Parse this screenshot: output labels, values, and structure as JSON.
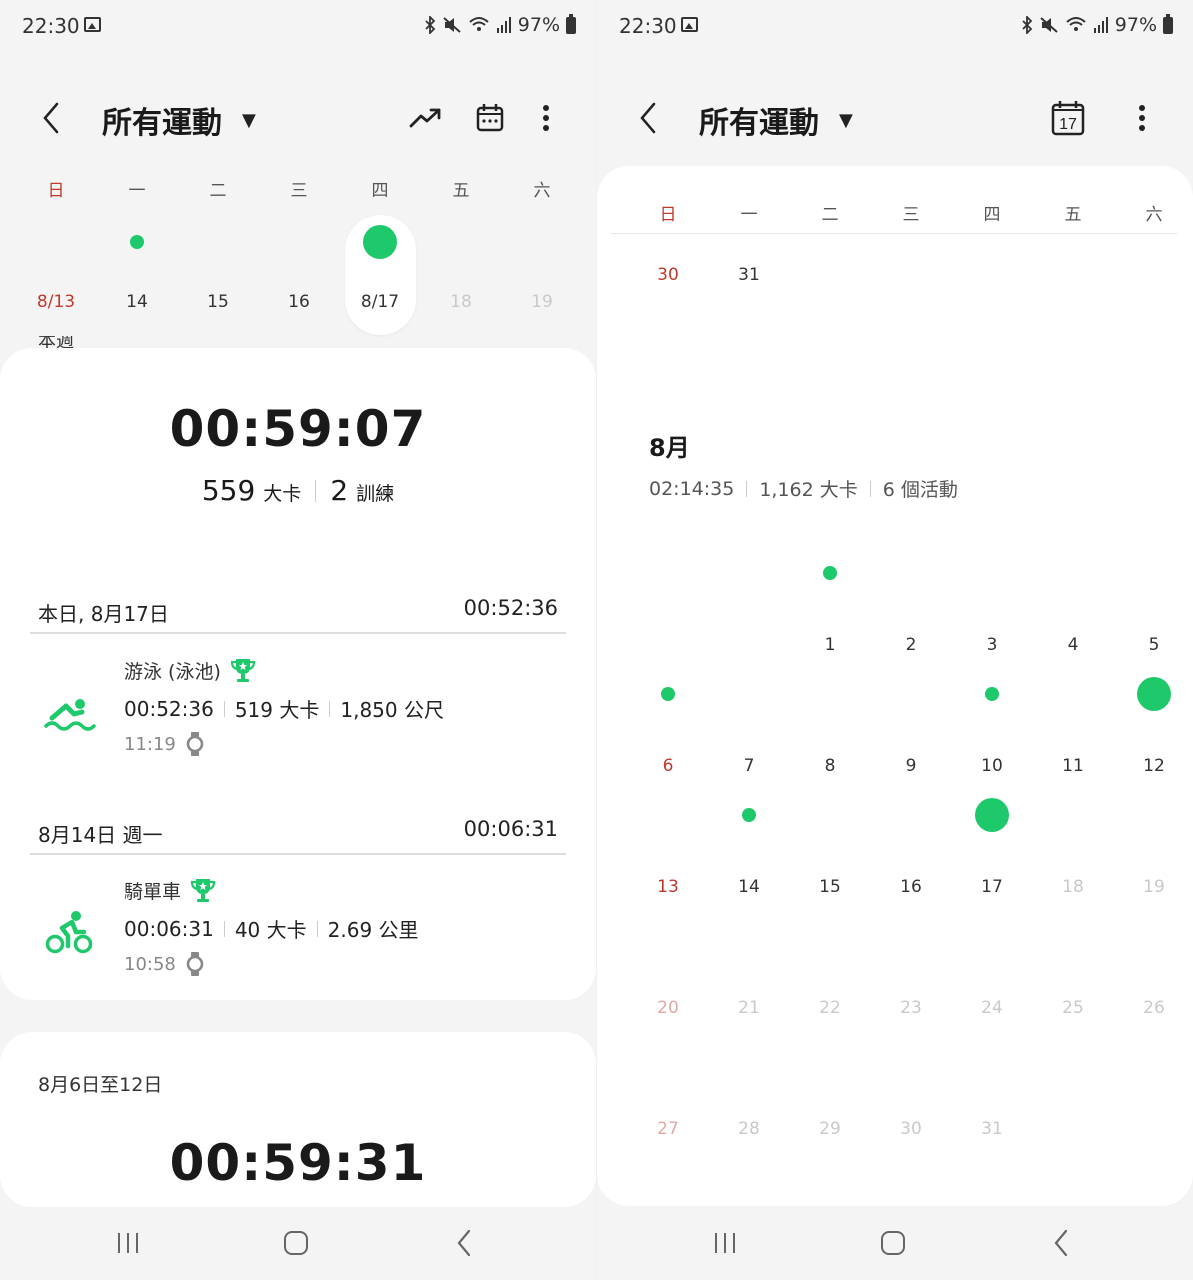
{
  "status": {
    "time": "22:30",
    "battery": "97%"
  },
  "left": {
    "title": "所有運動",
    "weekdays": [
      "日",
      "一",
      "二",
      "三",
      "四",
      "五",
      "六"
    ],
    "dates": [
      "8/13",
      "14",
      "15",
      "16",
      "8/17",
      "18",
      "19"
    ],
    "selected_index": 4,
    "week_label": "本週",
    "week_total_time": "00:59:07",
    "week_kcal_value": "559",
    "kcal_unit": "大卡",
    "week_workouts_value": "2",
    "workouts_unit": "訓練",
    "day1": {
      "label": "本日, 8月17日",
      "total": "00:52:36",
      "activity": {
        "name": "游泳 (泳池)",
        "duration": "00:52:36",
        "kcal": "519 大卡",
        "distance": "1,850 公尺",
        "start_time": "11:19"
      }
    },
    "day2": {
      "label": "8月14日 週一",
      "total": "00:06:31",
      "activity": {
        "name": "騎單車",
        "duration": "00:06:31",
        "kcal": "40 大卡",
        "distance": "2.69 公里",
        "start_time": "10:58"
      }
    },
    "prev_week_label": "8月6日至12日",
    "prev_week_total": "00:59:31"
  },
  "right": {
    "title": "所有運動",
    "calendar_icon_day": "17",
    "weekdays": [
      "日",
      "一",
      "二",
      "三",
      "四",
      "五",
      "六"
    ],
    "prev_month_tail": [
      "30",
      "31"
    ],
    "month_title": "8月",
    "month_time": "02:14:35",
    "month_kcal": "1,162 大卡",
    "month_count": "6 個活動",
    "weeks": [
      [
        "",
        "",
        "1",
        "2",
        "3",
        "4",
        "5"
      ],
      [
        "6",
        "7",
        "8",
        "9",
        "10",
        "11",
        "12"
      ],
      [
        "13",
        "14",
        "15",
        "16",
        "17",
        "18",
        "19"
      ],
      [
        "20",
        "21",
        "22",
        "23",
        "24",
        "25",
        "26"
      ],
      [
        "27",
        "28",
        "29",
        "30",
        "31",
        "",
        ""
      ]
    ]
  },
  "colors": {
    "accent": "#1ec96b",
    "sunday": "#c0392b",
    "future": "#c9c9c9"
  }
}
